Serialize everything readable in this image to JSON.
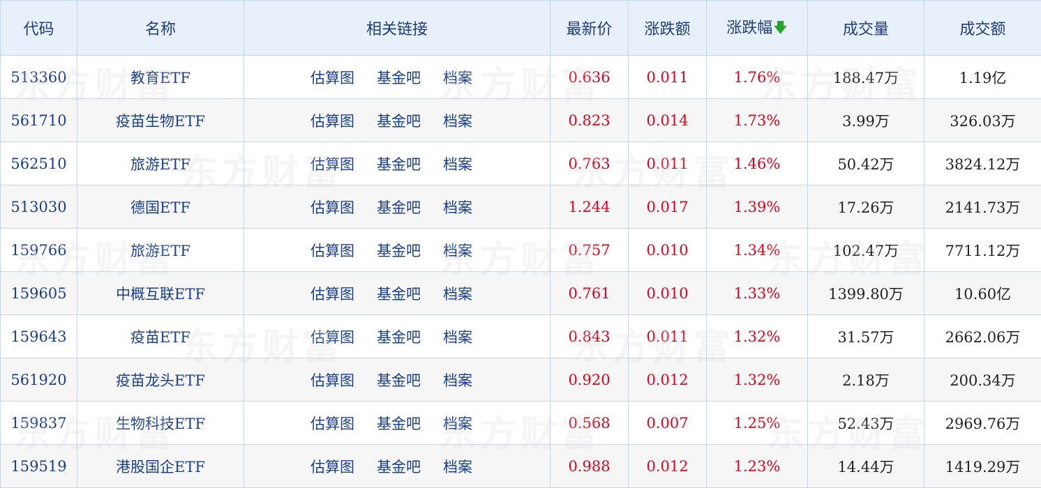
{
  "table": {
    "headers": {
      "code": "代码",
      "name": "名称",
      "links": "相关链接",
      "price": "最新价",
      "change": "涨跌额",
      "pct": "涨跌幅",
      "volume": "成交量",
      "amount": "成交额"
    },
    "sort_icon": "arrow-down-icon",
    "colors": {
      "up": "#e3001b",
      "link": "#1a3f8f",
      "header_bg": "#e7f0fb",
      "sort_arrow": "#26a52b"
    },
    "link_labels": [
      "估算图",
      "基金吧",
      "档案"
    ],
    "rows": [
      {
        "code": "513360",
        "name": "教育ETF",
        "price": "0.636",
        "change": "0.011",
        "pct": "1.76%",
        "volume": "188.47万",
        "amount": "1.19亿"
      },
      {
        "code": "561710",
        "name": "疫苗生物ETF",
        "price": "0.823",
        "change": "0.014",
        "pct": "1.73%",
        "volume": "3.99万",
        "amount": "326.03万"
      },
      {
        "code": "562510",
        "name": "旅游ETF",
        "price": "0.763",
        "change": "0.011",
        "pct": "1.46%",
        "volume": "50.42万",
        "amount": "3824.12万"
      },
      {
        "code": "513030",
        "name": "德国ETF",
        "price": "1.244",
        "change": "0.017",
        "pct": "1.39%",
        "volume": "17.26万",
        "amount": "2141.73万"
      },
      {
        "code": "159766",
        "name": "旅游ETF",
        "price": "0.757",
        "change": "0.010",
        "pct": "1.34%",
        "volume": "102.47万",
        "amount": "7711.12万"
      },
      {
        "code": "159605",
        "name": "中概互联ETF",
        "price": "0.761",
        "change": "0.010",
        "pct": "1.33%",
        "volume": "1399.80万",
        "amount": "10.60亿"
      },
      {
        "code": "159643",
        "name": "疫苗ETF",
        "price": "0.843",
        "change": "0.011",
        "pct": "1.32%",
        "volume": "31.57万",
        "amount": "2662.06万"
      },
      {
        "code": "561920",
        "name": "疫苗龙头ETF",
        "price": "0.920",
        "change": "0.012",
        "pct": "1.32%",
        "volume": "2.18万",
        "amount": "200.34万"
      },
      {
        "code": "159837",
        "name": "生物科技ETF",
        "price": "0.568",
        "change": "0.007",
        "pct": "1.25%",
        "volume": "52.43万",
        "amount": "2969.76万"
      },
      {
        "code": "159519",
        "name": "港股国企ETF",
        "price": "0.988",
        "change": "0.012",
        "pct": "1.23%",
        "volume": "14.44万",
        "amount": "1419.29万"
      }
    ],
    "watermark": "东方财富"
  }
}
